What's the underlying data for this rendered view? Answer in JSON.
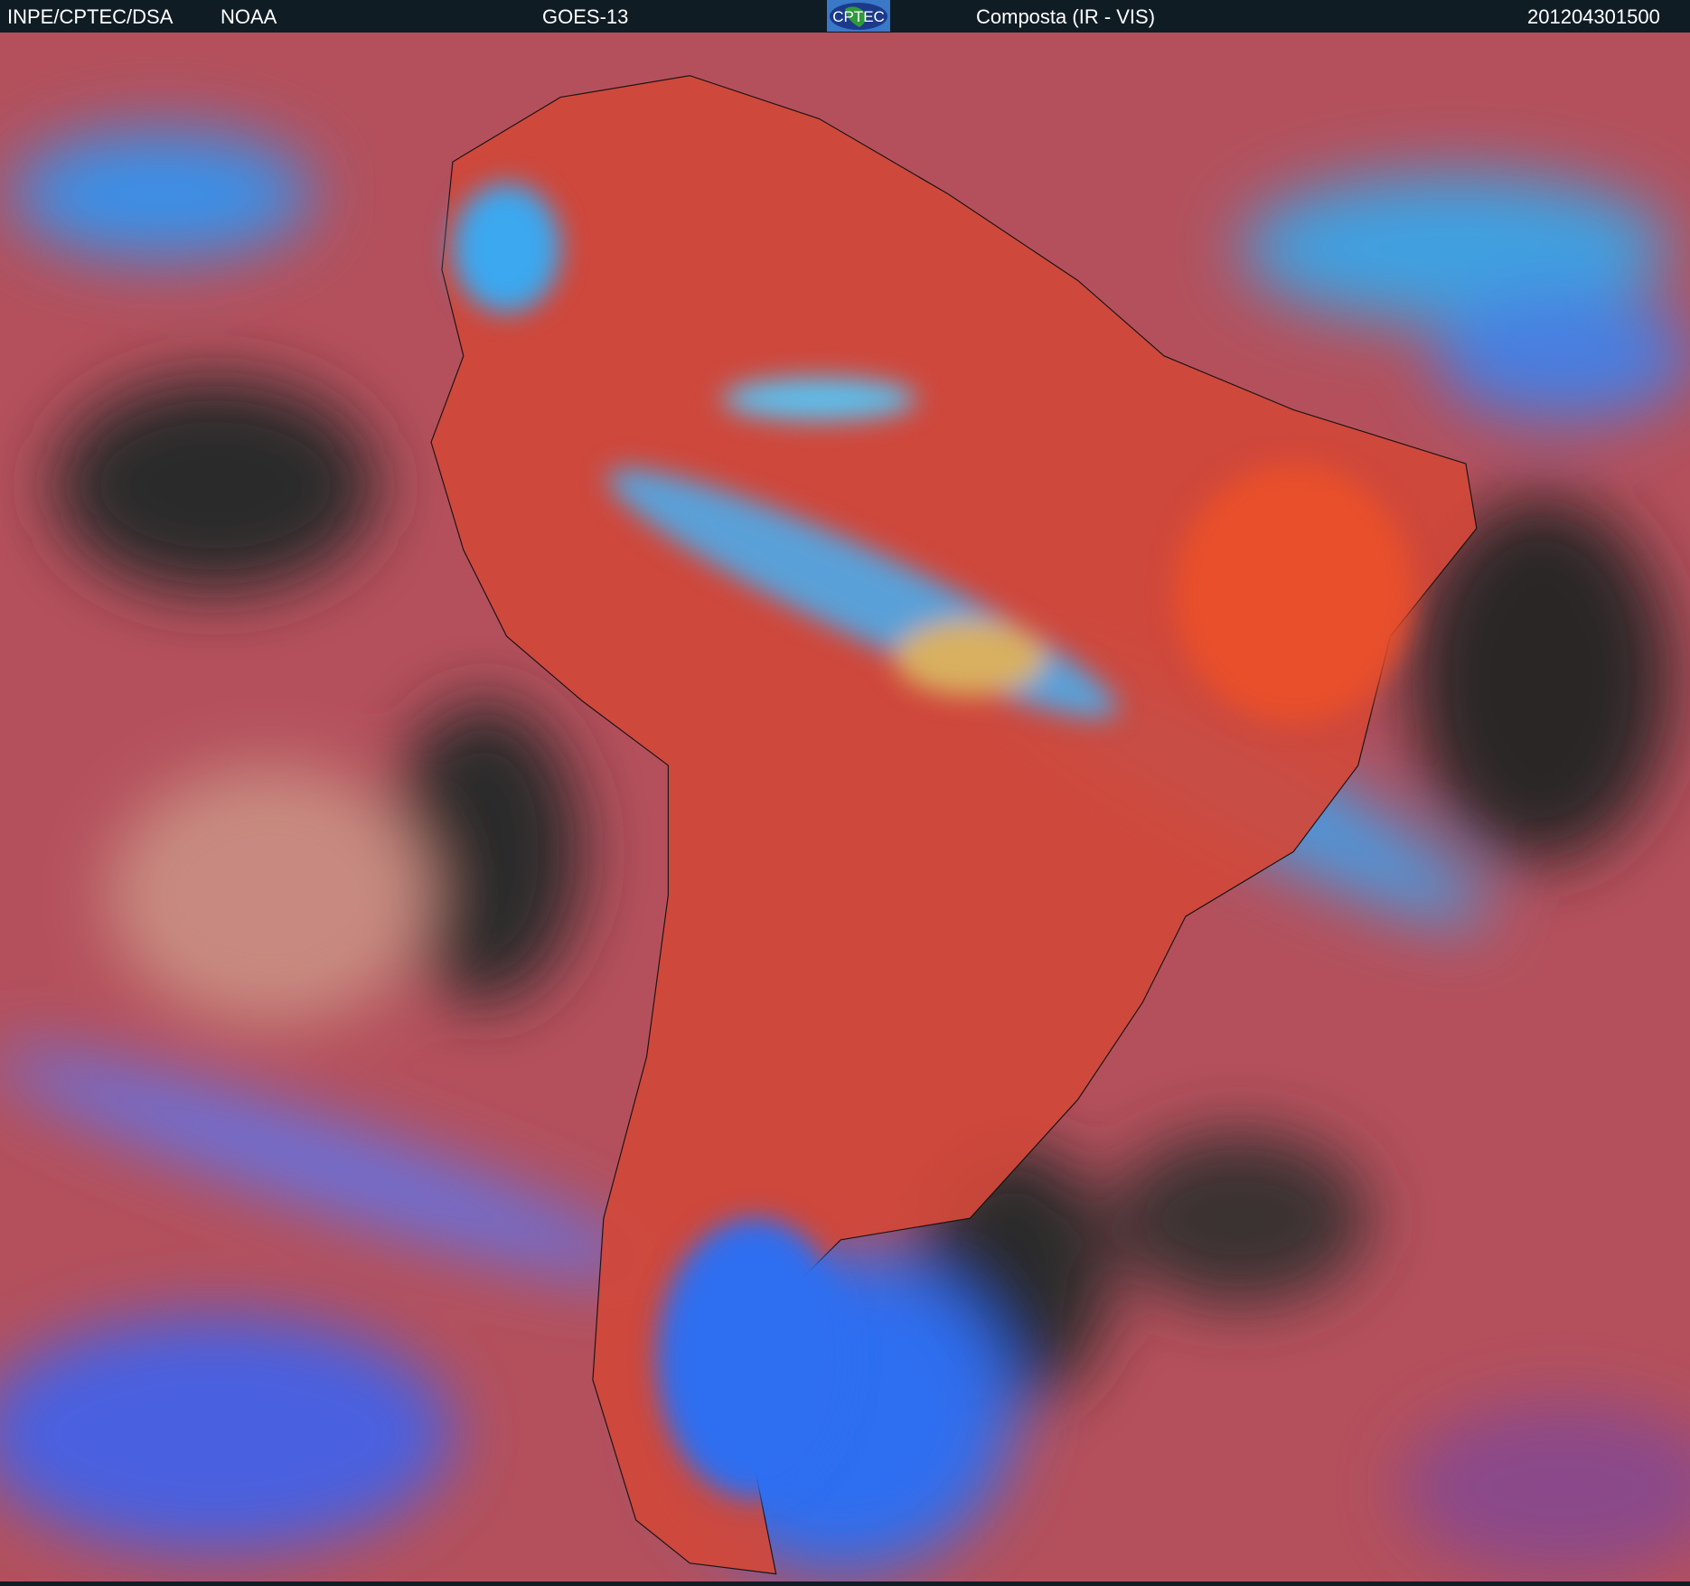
{
  "header": {
    "source": "INPE/CPTEC/DSA",
    "agency": "NOAA",
    "satellite": "GOES-13",
    "logo_text": "CPTEC",
    "product": "Composta (IR - VIS)",
    "timestamp": "201204301500"
  },
  "colors": {
    "header_bg": "#101c24",
    "land_warm": "#d8442c",
    "cloud_cold": "#2f8cf0",
    "clear_ocean": "#2a2828",
    "mid_cloud": "#b85a6a"
  }
}
